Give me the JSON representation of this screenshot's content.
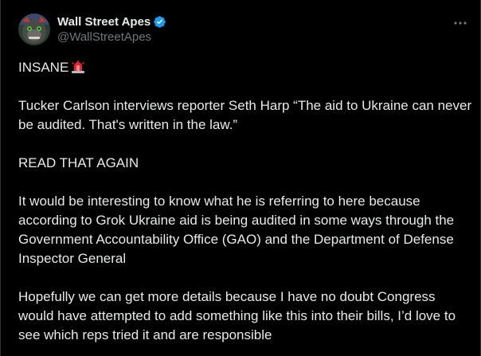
{
  "author": {
    "display_name": "Wall Street Apes",
    "handle": "@WallStreetApes",
    "verified": true,
    "avatar_icon": "gorilla-avatar-icon"
  },
  "menu": {
    "icon": "more-options-icon"
  },
  "post": {
    "headline": "INSANE",
    "headline_emoji": "police-siren-emoji",
    "paragraphs": [
      "Tucker Carlson interviews reporter Seth Harp “The aid to Ukraine can never be audited. That's written in the law.”",
      "READ THAT AGAIN",
      "It would be interesting to know what he is referring to here because according to Grok Ukraine aid is being audited in some ways through the Government Accountability Office (GAO) and the Department of Defense Inspector General",
      "Hopefully we can get more details because I have no doubt Congress would have attempted to add something like this into their bills, I’d love to see which reps tried it and are responsible"
    ]
  },
  "colors": {
    "background": "#000000",
    "text": "#e7e9ea",
    "secondary_text": "#71767b",
    "verified_badge": "#1d9bf0",
    "siren": "#e0262f"
  }
}
